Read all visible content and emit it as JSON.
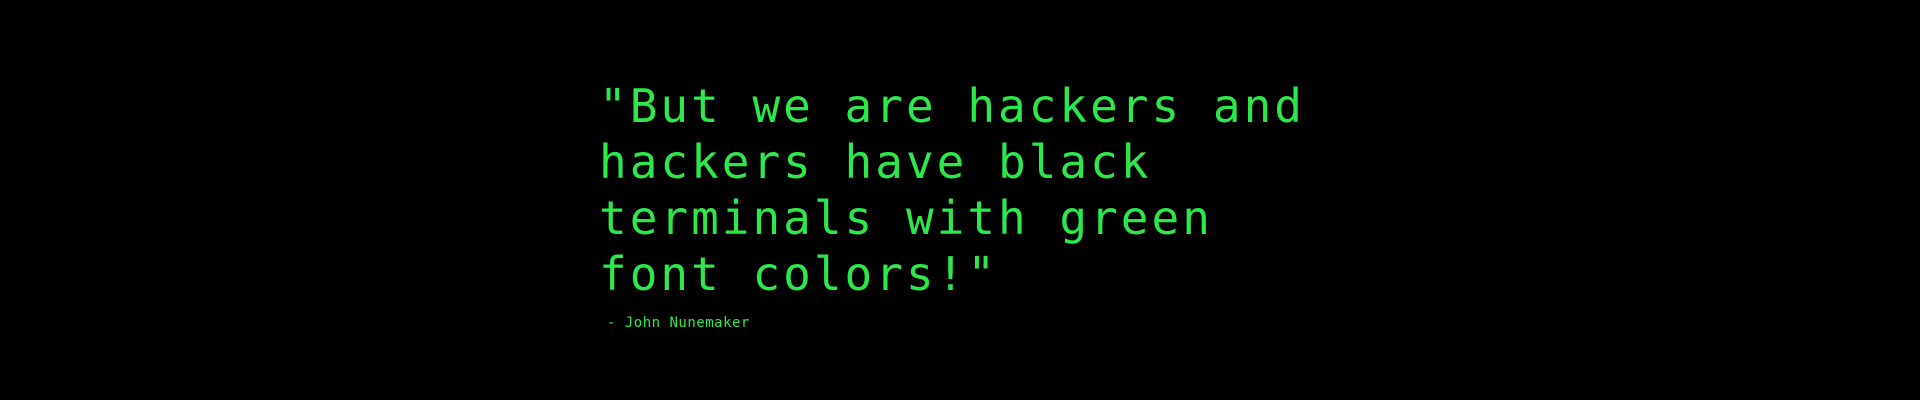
{
  "quote": {
    "lines": [
      "\"But we are hackers and",
      "hackers have black",
      "terminals with green",
      "font colors!\""
    ],
    "attribution": "- John Nunemaker"
  },
  "colors": {
    "background": "#000000",
    "text": "#2de84a"
  }
}
